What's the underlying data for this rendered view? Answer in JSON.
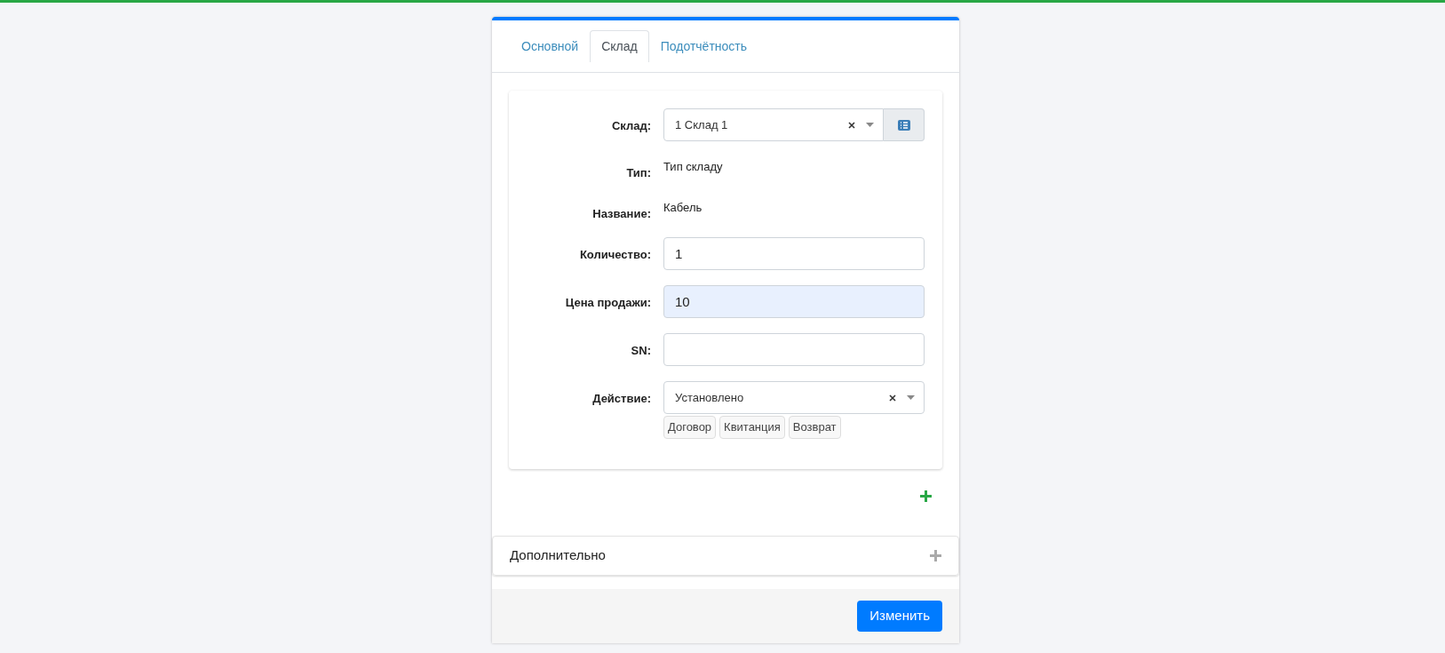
{
  "tabs": [
    {
      "label": "Основной",
      "selected": false
    },
    {
      "label": "Склад",
      "selected": true
    },
    {
      "label": "Подотчётность",
      "selected": false
    }
  ],
  "fields": [
    {
      "kind": "select",
      "label": "Склад:",
      "value": "1 Склад 1",
      "clearable": true,
      "addon": true
    },
    {
      "kind": "static",
      "label": "Тип:",
      "value": "Тип складу"
    },
    {
      "kind": "static",
      "label": "Название:",
      "value": "Кабель"
    },
    {
      "kind": "input",
      "label": "Количество:",
      "value": "1",
      "highlighted": false
    },
    {
      "kind": "input",
      "label": "Цена продажи:",
      "value": "10",
      "highlighted": true
    },
    {
      "kind": "input",
      "label": "SN:",
      "highlighted": false
    },
    {
      "kind": "select",
      "label": "Действие:",
      "value": "Установлено",
      "clearable": true,
      "addon": false,
      "options": [
        "Договор",
        "Квитанция",
        "Возврат"
      ]
    }
  ],
  "extra_panel": {
    "title": "Дополнительно",
    "expanded": false
  },
  "submit_button": "Изменить"
}
